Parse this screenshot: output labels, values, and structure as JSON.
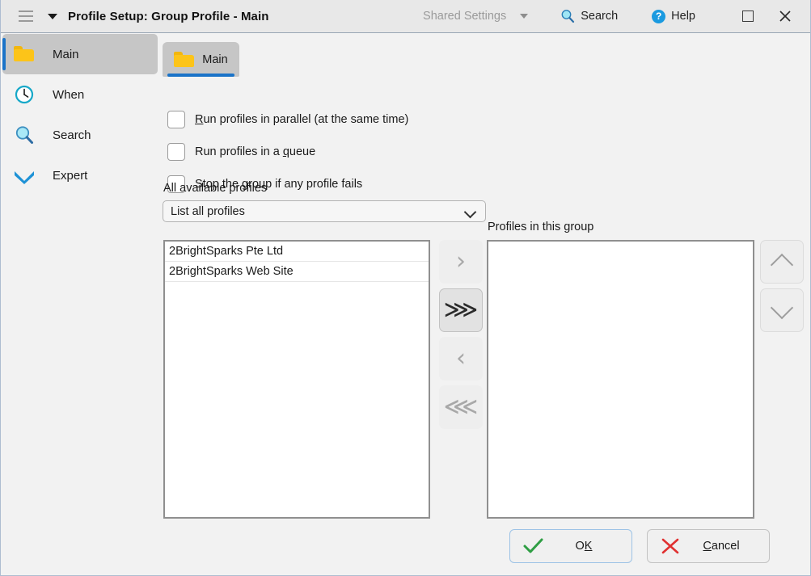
{
  "titlebar": {
    "menu_icon": "hamburger-icon",
    "caret_icon": "caret-down-icon",
    "title": "Profile Setup: Group Profile - Main",
    "shared_settings": "Shared Settings",
    "search": "Search",
    "search_icon": "magnifier-icon",
    "help": "Help",
    "help_icon": "question-circle-icon",
    "maximize_icon": "maximize-square-icon",
    "close_icon": "close-x-icon"
  },
  "sidebar": {
    "items": [
      {
        "label": "Main",
        "icon": "folder-icon",
        "active": true
      },
      {
        "label": "When",
        "icon": "clock-icon",
        "active": false
      },
      {
        "label": "Search",
        "icon": "magnifier-icon",
        "active": false
      },
      {
        "label": "Expert",
        "icon": "chevron-double-down-icon",
        "active": false
      }
    ]
  },
  "main": {
    "tab": {
      "label": "Main",
      "icon": "folder-icon"
    },
    "checkboxes": [
      {
        "pre": "",
        "acc": "R",
        "post": "un profiles in parallel (at the same time)",
        "checked": false
      },
      {
        "pre": "Run profiles in a ",
        "acc": "q",
        "post": "ueue",
        "checked": false
      },
      {
        "pre": "Stop the ",
        "acc": "g",
        "post": "roup if any profile fails",
        "checked": false
      }
    ],
    "available_label": "All available profiles",
    "filter_value": "List all profiles",
    "filter_options": [
      "List all profiles"
    ],
    "available_profiles": [
      "2BrightSparks Pte Ltd",
      "2BrightSparks Web Site"
    ],
    "group_label": "Profiles in this group",
    "group_profiles": [],
    "transfer_buttons": [
      {
        "name": "move-right-button",
        "glyph": "›",
        "enabled": false,
        "hover": false
      },
      {
        "name": "move-all-right-button",
        "glyph": "⋙",
        "enabled": true,
        "hover": true
      },
      {
        "name": "move-left-button",
        "glyph": "‹",
        "enabled": false,
        "hover": false
      },
      {
        "name": "move-all-left-button",
        "glyph": "⋘",
        "enabled": false,
        "hover": false
      }
    ],
    "order_buttons": [
      {
        "name": "move-up-button",
        "icon": "chevron-up-icon"
      },
      {
        "name": "move-down-button",
        "icon": "chevron-down-icon"
      }
    ]
  },
  "footer": {
    "ok": {
      "pre": "O",
      "acc": "K",
      "post": "",
      "icon": "check-icon"
    },
    "cancel": {
      "pre": "",
      "acc": "C",
      "post": "ancel",
      "icon": "x-icon"
    }
  },
  "colors": {
    "accent": "#1a73c8",
    "folder": "#fcc419",
    "ok_check": "#2f9e44",
    "cancel_x": "#e03131",
    "help_blue": "#1a9ae0"
  }
}
